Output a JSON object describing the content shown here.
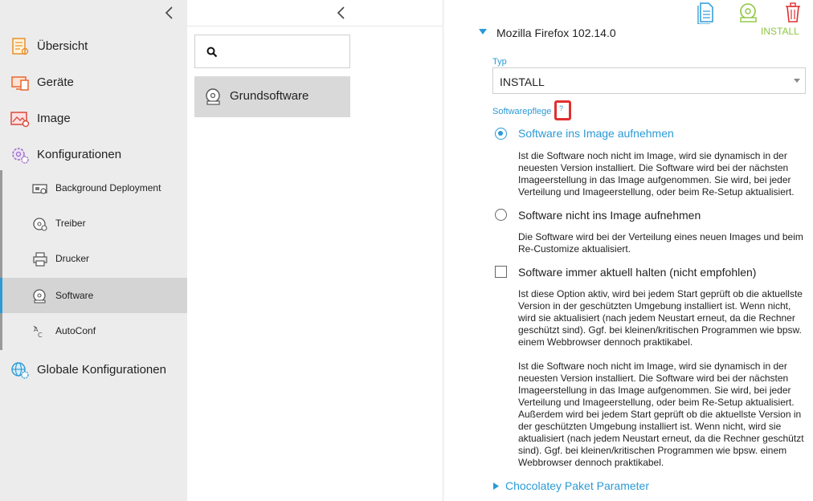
{
  "nav": {
    "items": [
      {
        "label": "Übersicht"
      },
      {
        "label": "Geräte"
      },
      {
        "label": "Image"
      },
      {
        "label": "Konfigurationen"
      },
      {
        "label": "Globale Konfigurationen"
      }
    ],
    "sub_items": [
      {
        "label": "Background Deployment"
      },
      {
        "label": "Treiber"
      },
      {
        "label": "Drucker"
      },
      {
        "label": "Software",
        "active": true
      },
      {
        "label": "AutoConf"
      }
    ]
  },
  "middle": {
    "search_value": "",
    "items": [
      {
        "label": "Grundsoftware"
      }
    ]
  },
  "detail": {
    "title": "Mozilla Firefox 102.14.0",
    "badge": "INSTALL",
    "typ_label": "Typ",
    "typ_value": "INSTALL",
    "pflege_label": "Softwarepflege",
    "help_glyph": "?",
    "options": [
      {
        "label": "Software ins Image aufnehmen",
        "selected": true,
        "description": "Ist die Software noch nicht im Image, wird sie dynamisch in der neuesten Version installiert. Die Software wird bei der nächsten Imageerstellung in das Image aufgenommen. Sie wird, bei jeder Verteilung und Imageerstellung, oder beim Re-Setup aktualisiert."
      },
      {
        "label": "Software nicht ins Image aufnehmen",
        "selected": false,
        "description": "Die Software wird bei der Verteilung eines neuen Images und beim Re-Customize aktualisiert."
      }
    ],
    "checkbox": {
      "label": "Software immer aktuell halten (nicht empfohlen)",
      "checked": false,
      "description_1": "Ist diese Option aktiv, wird bei jedem Start geprüft ob die aktuellste Version in der geschützten Umgebung installiert ist. Wenn nicht, wird sie aktualisiert (nach jedem Neustart erneut, da die Rechner geschützt sind). Ggf. bei kleinen/kritischen Programmen wie bpsw. einem Webbrowser dennoch praktikabel.",
      "description_2": "Ist die Software noch nicht im Image, wird sie dynamisch in der neuesten Version installiert. Die Software wird bei der nächsten Imageerstellung in das Image aufgenommen. Sie wird, bei jeder Verteilung und Imageerstellung, oder beim Re-Setup aktualisiert. Außerdem wird bei jedem Start geprüft ob die aktuellste Version in der geschützten Umgebung installiert ist. Wenn nicht, wird sie aktualisiert (nach jedem Neustart erneut, da die Rechner geschützt sind). Ggf. bei kleinen/kritischen Programmen wie bpsw. einem Webbrowser dennoch praktikabel."
    },
    "section": {
      "label": "Chocolatey Paket Parameter"
    }
  },
  "colors": {
    "accent": "#2b9ad6",
    "install_green": "#8dc63f",
    "delete_red": "#e03030",
    "nav_bg": "#ececec"
  },
  "icons": [
    "chevron-left-icon",
    "overview-icon",
    "devices-icon",
    "image-icon",
    "config-gear-icon",
    "global-config-icon",
    "deployment-icon",
    "driver-disc-icon",
    "printer-icon",
    "software-disc-icon",
    "autoconf-icon",
    "search-icon",
    "document-icon",
    "install-disc-icon",
    "trash-icon"
  ]
}
